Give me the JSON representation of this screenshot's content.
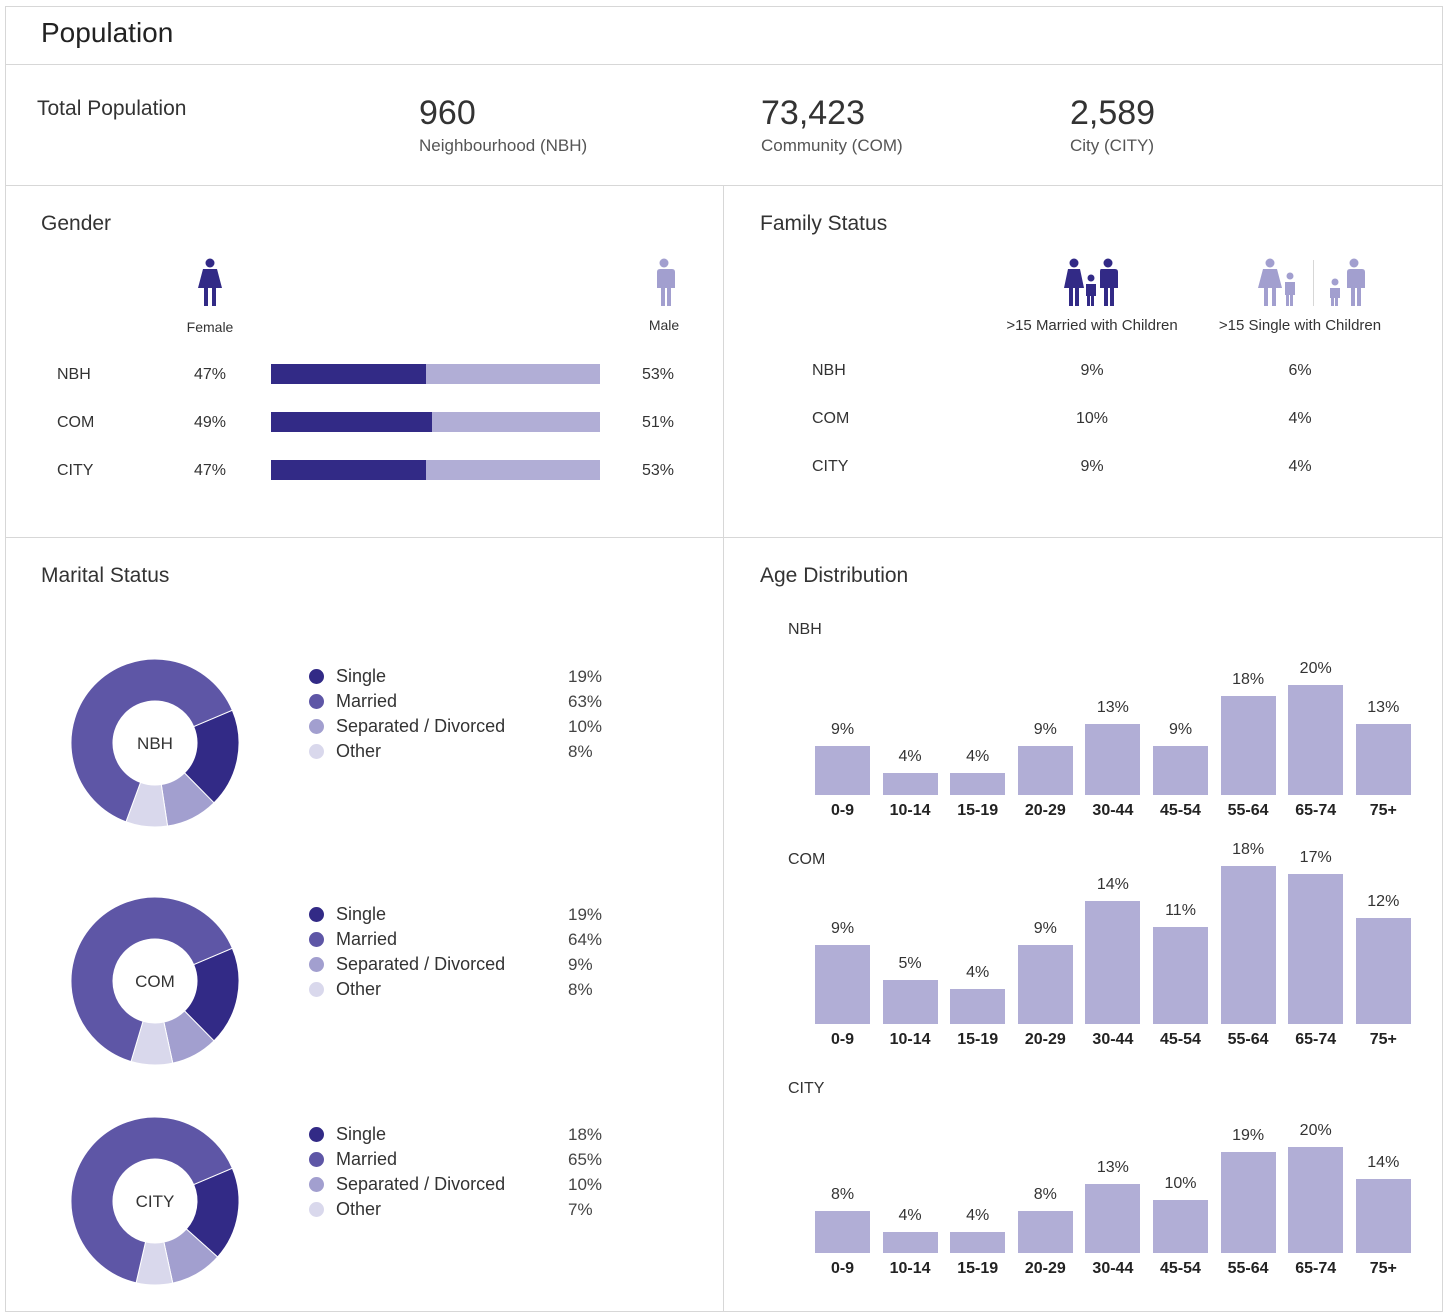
{
  "header": {
    "title": "Population"
  },
  "total_population": {
    "label": "Total Population",
    "stats": [
      {
        "value": "960",
        "label": "Neighbourhood (NBH)"
      },
      {
        "value": "73,423",
        "label": "Community (COM)"
      },
      {
        "value": "2,589",
        "label": "City (CITY)"
      }
    ]
  },
  "gender": {
    "title": "Gender",
    "female_label": "Female",
    "male_label": "Male",
    "rows": [
      {
        "area": "NBH",
        "female": "47%",
        "male": "53%",
        "female_frac": 0.47
      },
      {
        "area": "COM",
        "female": "49%",
        "male": "51%",
        "female_frac": 0.49
      },
      {
        "area": "CITY",
        "female": "47%",
        "male": "53%",
        "female_frac": 0.47
      }
    ]
  },
  "family": {
    "title": "Family Status",
    "col1": ">15 Married with Children",
    "col2": ">15 Single with Children",
    "rows": [
      {
        "area": "NBH",
        "married": "9%",
        "single": "6%"
      },
      {
        "area": "COM",
        "married": "10%",
        "single": "4%"
      },
      {
        "area": "CITY",
        "married": "9%",
        "single": "4%"
      }
    ]
  },
  "colors": {
    "single": "#322a86",
    "married": "#5e56a6",
    "separated": "#a29fcf",
    "other": "#d9d8ec",
    "bar": "#b1aed6"
  },
  "chart_data": [
    {
      "type": "pie",
      "title": "Marital Status",
      "center_label": "NBH",
      "categories": [
        "Single",
        "Married",
        "Separated / Divorced",
        "Other"
      ],
      "values": [
        19,
        63,
        10,
        8
      ],
      "labels": [
        "19%",
        "63%",
        "10%",
        "8%"
      ]
    },
    {
      "type": "pie",
      "center_label": "COM",
      "categories": [
        "Single",
        "Married",
        "Separated / Divorced",
        "Other"
      ],
      "values": [
        19,
        64,
        9,
        8
      ],
      "labels": [
        "19%",
        "64%",
        "9%",
        "8%"
      ]
    },
    {
      "type": "pie",
      "center_label": "CITY",
      "categories": [
        "Single",
        "Married",
        "Separated / Divorced",
        "Other"
      ],
      "values": [
        18,
        65,
        10,
        7
      ],
      "labels": [
        "18%",
        "65%",
        "10%",
        "7%"
      ]
    },
    {
      "type": "bar",
      "title": "Age Distribution",
      "subtitle": "NBH",
      "categories": [
        "0-9",
        "10-14",
        "15-19",
        "20-29",
        "30-44",
        "45-54",
        "55-64",
        "65-74",
        "75+"
      ],
      "values": [
        9,
        4,
        4,
        9,
        13,
        9,
        18,
        20,
        13
      ],
      "labels": [
        "9%",
        "4%",
        "4%",
        "9%",
        "13%",
        "9%",
        "18%",
        "20%",
        "13%"
      ]
    },
    {
      "type": "bar",
      "subtitle": "COM",
      "categories": [
        "0-9",
        "10-14",
        "15-19",
        "20-29",
        "30-44",
        "45-54",
        "55-64",
        "65-74",
        "75+"
      ],
      "values": [
        9,
        5,
        4,
        9,
        14,
        11,
        18,
        17,
        12
      ],
      "labels": [
        "9%",
        "5%",
        "4%",
        "9%",
        "14%",
        "11%",
        "18%",
        "17%",
        "12%"
      ]
    },
    {
      "type": "bar",
      "subtitle": "CITY",
      "categories": [
        "0-9",
        "10-14",
        "15-19",
        "20-29",
        "30-44",
        "45-54",
        "55-64",
        "65-74",
        "75+"
      ],
      "values": [
        8,
        4,
        4,
        8,
        13,
        10,
        19,
        20,
        14
      ],
      "labels": [
        "8%",
        "4%",
        "4%",
        "8%",
        "13%",
        "10%",
        "19%",
        "20%",
        "14%"
      ]
    }
  ]
}
